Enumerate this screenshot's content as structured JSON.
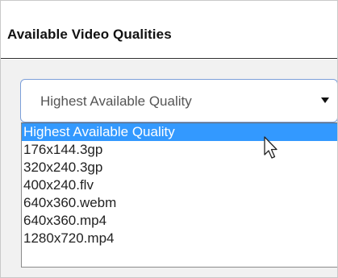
{
  "panel": {
    "title": "Available Video Qualities"
  },
  "select": {
    "current_value": "Highest Available Quality",
    "arrow_icon": "caret-down-icon"
  },
  "options": [
    {
      "label": "Highest Available Quality",
      "selected": true
    },
    {
      "label": "176x144.3gp",
      "selected": false
    },
    {
      "label": "320x240.3gp",
      "selected": false
    },
    {
      "label": "400x240.flv",
      "selected": false
    },
    {
      "label": "640x360.webm",
      "selected": false
    },
    {
      "label": "640x360.mp4",
      "selected": false
    },
    {
      "label": "1280x720.mp4",
      "selected": false
    }
  ],
  "colors": {
    "selection": "#3399ff",
    "select_border": "#7c9fd9",
    "body_background": "#f1f1f1"
  },
  "cursor_icon": "mouse-pointer-icon"
}
